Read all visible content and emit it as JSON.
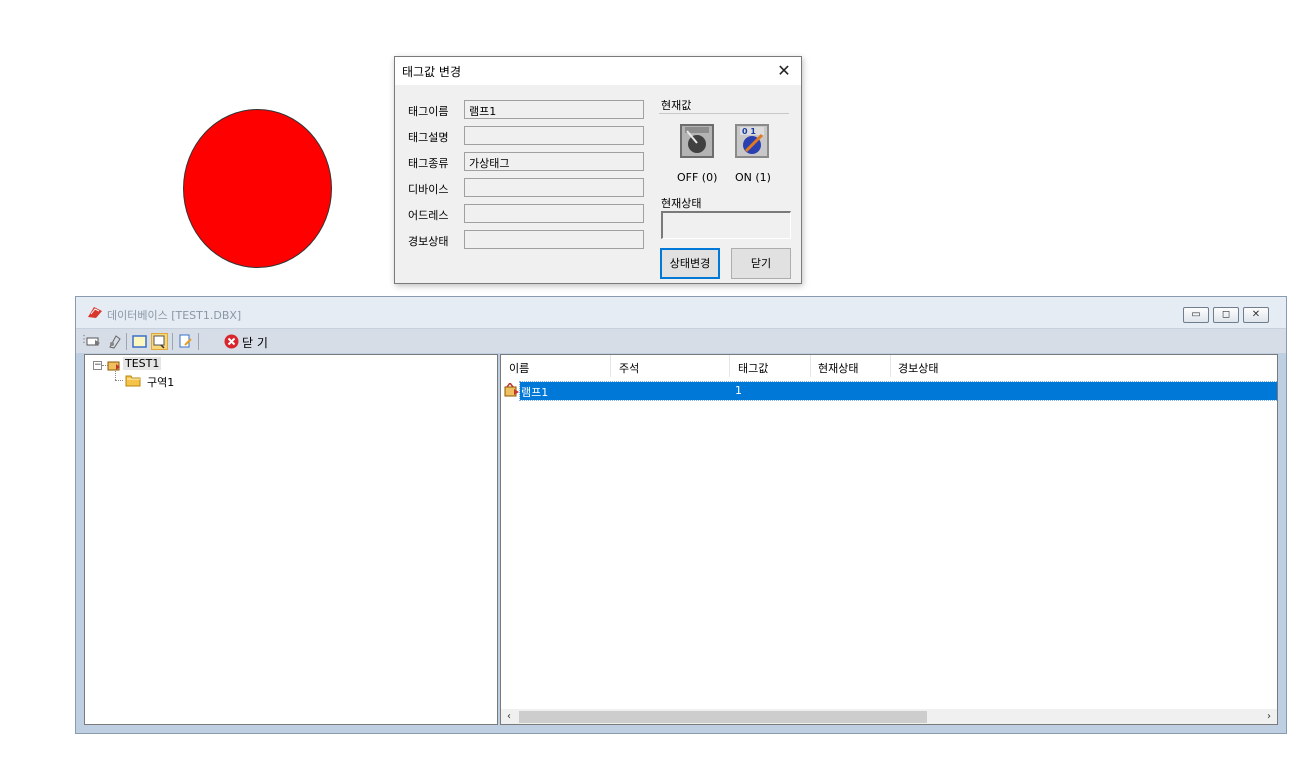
{
  "lamp": {
    "color": "#ff0000"
  },
  "dialog": {
    "title": "태그값 변경",
    "close_icon": "close-icon",
    "fields": [
      {
        "label": "태그이름",
        "value": "램프1"
      },
      {
        "label": "태그설명",
        "value": ""
      },
      {
        "label": "태그종류",
        "value": "가상태그"
      },
      {
        "label": "디바이스",
        "value": ""
      },
      {
        "label": "어드레스",
        "value": ""
      },
      {
        "label": "경보상태",
        "value": ""
      }
    ],
    "current_value_label": "현재값",
    "off_caption": "OFF (0)",
    "on_caption": "ON (1)",
    "switch_on_digits": "0 1",
    "current_state_label": "현재상태",
    "current_state_value": "",
    "change_state_button": "상태변경",
    "close_button": "닫기",
    "accent": "#0078d7"
  },
  "db": {
    "title": "데이터베이스 [TEST1.DBX]",
    "toolbar_close_label": "닫 기",
    "tree": {
      "root": "TEST1",
      "child": "구역1"
    },
    "list": {
      "columns": [
        "이름",
        "주석",
        "태그값",
        "현재상태",
        "경보상태"
      ],
      "rows": [
        {
          "name": "램프1",
          "comment": "",
          "value": "1",
          "state": "",
          "alarm": ""
        }
      ],
      "selection_color": "#0078d7"
    }
  }
}
